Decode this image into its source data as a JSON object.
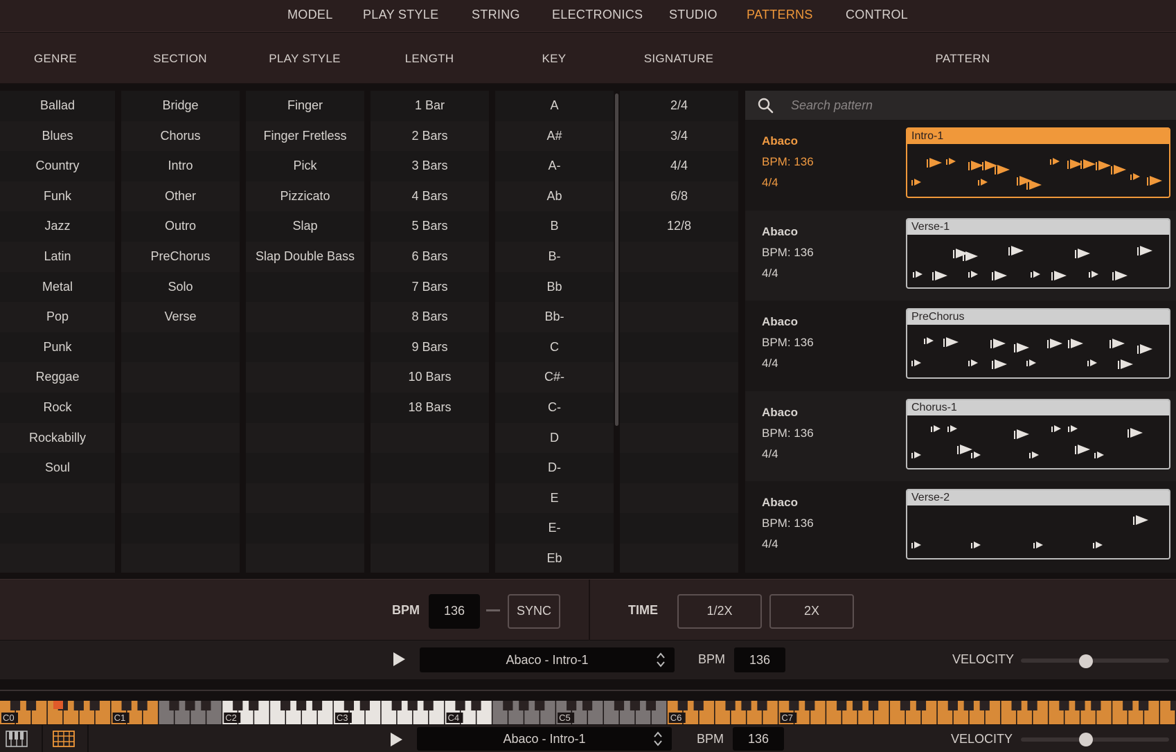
{
  "nav": {
    "tabs": [
      "MODEL",
      "PLAY STYLE",
      "STRING",
      "ELECTRONICS",
      "STUDIO",
      "PATTERNS",
      "CONTROL"
    ],
    "active": "PATTERNS"
  },
  "columns": {
    "headers": [
      "GENRE",
      "SECTION",
      "PLAY STYLE",
      "LENGTH",
      "KEY",
      "SIGNATURE",
      "PATTERN"
    ],
    "genre": [
      "Ballad",
      "Blues",
      "Country",
      "Funk",
      "Jazz",
      "Latin",
      "Metal",
      "Pop",
      "Punk",
      "Reggae",
      "Rock",
      "Rockabilly",
      "Soul"
    ],
    "section": [
      "Bridge",
      "Chorus",
      "Intro",
      "Other",
      "Outro",
      "PreChorus",
      "Solo",
      "Verse"
    ],
    "play_style": [
      "Finger",
      "Finger Fretless",
      "Pick",
      "Pizzicato",
      "Slap",
      "Slap Double Bass"
    ],
    "length": [
      "1 Bar",
      "2 Bars",
      "3 Bars",
      "4 Bars",
      "5 Bars",
      "6 Bars",
      "7 Bars",
      "8 Bars",
      "9 Bars",
      "10 Bars",
      "18 Bars"
    ],
    "key": [
      "A",
      "A#",
      "A-",
      "Ab",
      "B",
      "B-",
      "Bb",
      "Bb-",
      "C",
      "C#-",
      "C-",
      "D",
      "D-",
      "E",
      "E-",
      "Eb"
    ],
    "signature": [
      "2/4",
      "3/4",
      "4/4",
      "6/8",
      "12/8"
    ]
  },
  "search": {
    "placeholder": "Search pattern",
    "value": ""
  },
  "patterns": [
    {
      "name": "Abaco",
      "bpm": "BPM: 136",
      "sig": "4/4",
      "title": "Intro-1",
      "selected": true
    },
    {
      "name": "Abaco",
      "bpm": "BPM: 136",
      "sig": "4/4",
      "title": "Verse-1",
      "selected": false
    },
    {
      "name": "Abaco",
      "bpm": "BPM: 136",
      "sig": "4/4",
      "title": "PreChorus",
      "selected": false
    },
    {
      "name": "Abaco",
      "bpm": "BPM: 136",
      "sig": "4/4",
      "title": "Chorus-1",
      "selected": false
    },
    {
      "name": "Abaco",
      "bpm": "BPM: 136",
      "sig": "4/4",
      "title": "Verse-2",
      "selected": false
    }
  ],
  "tempo": {
    "bpm_label": "BPM",
    "bpm_value": "136",
    "sync_label": "SYNC",
    "time_label": "TIME",
    "half_label": "1/2X",
    "double_label": "2X"
  },
  "transport": {
    "pattern": "Abaco - Intro-1",
    "bpm_label": "BPM",
    "bpm_value": "136",
    "velocity_label": "VELOCITY",
    "velocity_level": 0.44
  },
  "transport2": {
    "pattern": "Abaco - Intro-1",
    "bpm_label": "BPM",
    "bpm_value": "136",
    "velocity_label": "VELOCITY",
    "velocity_level": 0.44
  },
  "keyboard": {
    "octave_labels": [
      "C0",
      "C1",
      "C2",
      "C3",
      "C4",
      "C5",
      "C6",
      "C7"
    ]
  },
  "colors": {
    "accent": "#f0983a",
    "keys_orange": "#d88a38",
    "keys_white": "#e8e4e0",
    "keys_gray": "#7a7474"
  },
  "icons": {
    "search": "search-icon",
    "play": "play-icon",
    "piano": "piano-icon",
    "grid": "grid-icon",
    "updown": "updown-arrows-icon"
  }
}
